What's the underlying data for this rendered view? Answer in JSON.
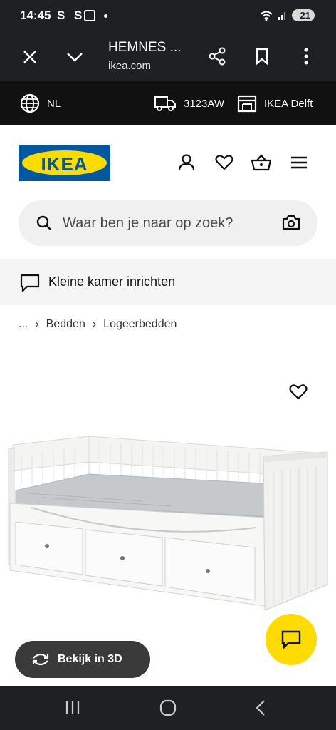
{
  "status": {
    "time": "14:45",
    "notif_icons": "S S",
    "battery": "21"
  },
  "browser": {
    "title": "HEMNES ...",
    "url": "ikea.com"
  },
  "store_bar": {
    "language": "NL",
    "postcode": "3123AW",
    "store": "IKEA Delft"
  },
  "header": {
    "logo_text": "IKEA"
  },
  "search": {
    "placeholder": "Waar ben je naar op zoek?"
  },
  "promo": {
    "link": "Kleine kamer inrichten"
  },
  "breadcrumb": {
    "ellipsis": "...",
    "items": [
      "Bedden",
      "Logeerbedden"
    ]
  },
  "product": {
    "view3d_label": "Bekijk in 3D"
  },
  "colors": {
    "ikea_blue": "#0058a3",
    "ikea_yellow": "#ffdb00",
    "dark_bar": "#1f2023"
  }
}
